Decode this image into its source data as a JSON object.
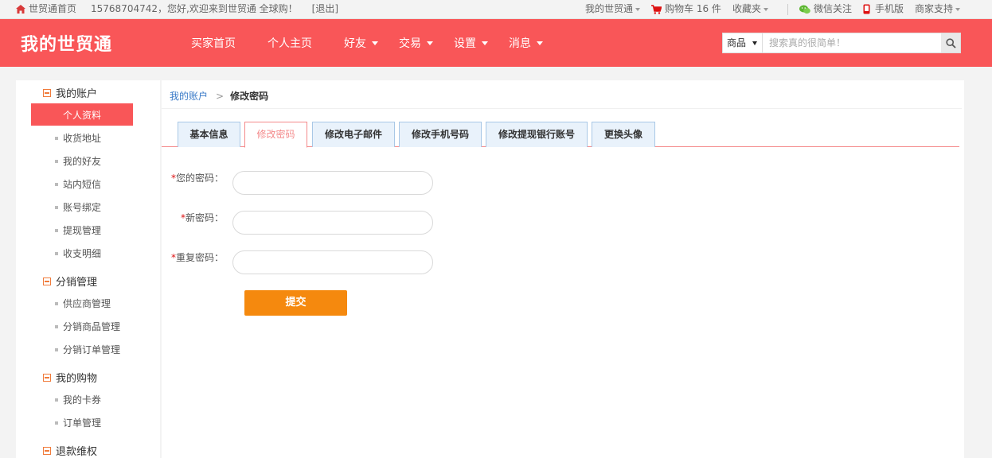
{
  "topbar": {
    "home": "世贸通首页",
    "greeting": "15768704742，您好,欢迎来到世贸通 全球购！",
    "logout": "[退出]",
    "my_shimaotong": "我的世贸通",
    "cart_prefix": "购物车",
    "cart_count": "16",
    "cart_suffix": "件",
    "favorites": "收藏夹",
    "wechat": "微信关注",
    "mobile": "手机版",
    "merchant": "商家支持"
  },
  "header": {
    "logo": "我的世贸通",
    "nav": [
      "买家首页",
      "个人主页",
      "好友",
      "交易",
      "设置",
      "消息"
    ],
    "search_category": "商品",
    "search_placeholder": "搜索真的很简单！",
    "brand_color": "#f95658"
  },
  "sidebar": {
    "sections": [
      {
        "title": "我的账户",
        "items": [
          "个人资料",
          "收货地址",
          "我的好友",
          "站内短信",
          "账号绑定",
          "提现管理",
          "收支明细"
        ]
      },
      {
        "title": "分销管理",
        "items": [
          "供应商管理",
          "分销商品管理",
          "分销订单管理"
        ]
      },
      {
        "title": "我的购物",
        "items": [
          "我的卡券",
          "订单管理"
        ]
      },
      {
        "title": "退款维权",
        "items": []
      }
    ],
    "active_item": "个人资料"
  },
  "main": {
    "breadcrumb": {
      "parent": "我的账户",
      "separator": ">",
      "current": "修改密码"
    },
    "tabs": [
      "基本信息",
      "修改密码",
      "修改电子邮件",
      "修改手机号码",
      "修改提现银行账号",
      "更换头像"
    ],
    "active_tab": "修改密码",
    "form": {
      "required_mark": "*",
      "current_password_label": "您的密码：",
      "new_password_label": "新密码：",
      "repeat_password_label": "重复密码：",
      "submit": "提交"
    }
  }
}
